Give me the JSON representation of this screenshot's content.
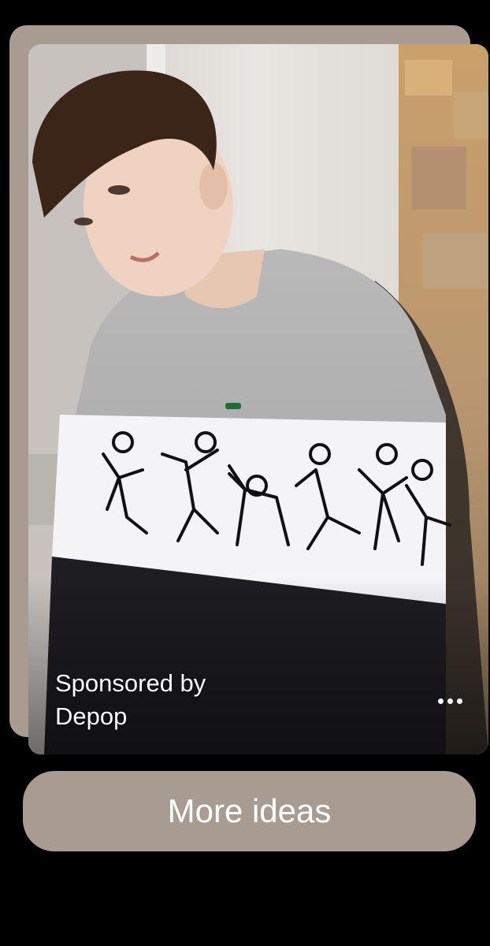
{
  "pin": {
    "sponsored_line1": "Sponsored by",
    "sponsored_line2": "Depop",
    "more_options_icon": "ellipsis-horizontal-icon",
    "image_alt": "Person wearing grey sweater with black doodle figure print stripe"
  },
  "actions": {
    "more_ideas_label": "More ideas"
  },
  "colors": {
    "background": "#000000",
    "card_accent": "#a89b91",
    "text": "#ffffff"
  }
}
